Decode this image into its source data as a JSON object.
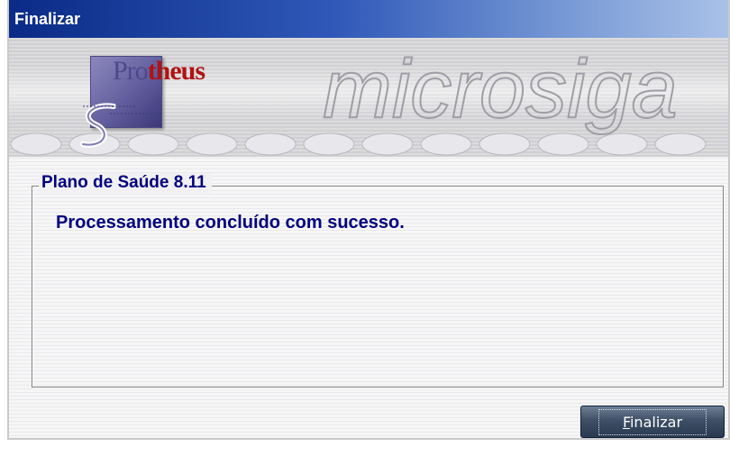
{
  "window": {
    "title": "Finalizar"
  },
  "banner": {
    "logo_text_prefix": "Pro",
    "logo_text_suffix": "theus",
    "wordmark": "microsiga"
  },
  "group": {
    "legend": "Plano de Saúde 8.11",
    "message": "Processamento concluído com sucesso."
  },
  "buttons": {
    "finish_label_mnemonic": "F",
    "finish_label_rest": "inalizar"
  },
  "colors": {
    "title_gradient_start": "#0a2b86",
    "title_gradient_end": "#a9c1e8",
    "text_navy": "#000080",
    "logo_red": "#b01313",
    "button_dark": "#2a3a50"
  }
}
